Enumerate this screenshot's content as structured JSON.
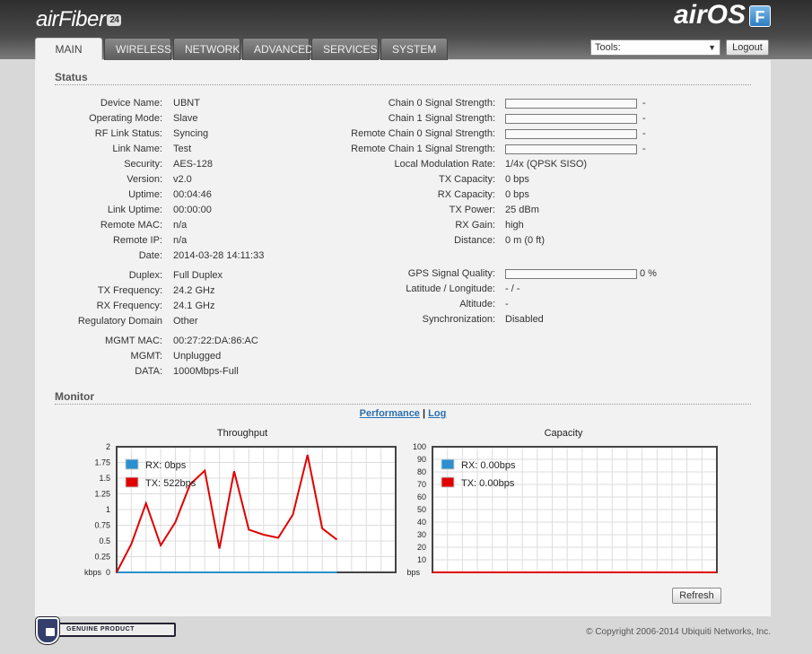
{
  "header": {
    "brand": "airFiber",
    "brand_model": "24",
    "os_name": "airOS",
    "os_badge": "F",
    "tabs": [
      {
        "label": "MAIN",
        "active": true
      },
      {
        "label": "WIRELESS",
        "active": false
      },
      {
        "label": "NETWORK",
        "active": false
      },
      {
        "label": "ADVANCED",
        "active": false
      },
      {
        "label": "SERVICES",
        "active": false
      },
      {
        "label": "SYSTEM",
        "active": false
      }
    ],
    "tools_label": "Tools:",
    "logout_label": "Logout"
  },
  "status": {
    "title": "Status",
    "left": [
      {
        "label": "Device Name:",
        "value": "UBNT"
      },
      {
        "label": "Operating Mode:",
        "value": "Slave"
      },
      {
        "label": "RF Link Status:",
        "value": "Syncing"
      },
      {
        "label": "Link Name:",
        "value": "Test"
      },
      {
        "label": "Security:",
        "value": "AES-128"
      },
      {
        "label": "Version:",
        "value": "v2.0"
      },
      {
        "label": "Uptime:",
        "value": "00:04:46"
      },
      {
        "label": "Link Uptime:",
        "value": "00:00:00"
      },
      {
        "label": "Remote MAC:",
        "value": "n/a"
      },
      {
        "label": "Remote IP:",
        "value": "n/a"
      },
      {
        "label": "Date:",
        "value": "2014-03-28 14:11:33"
      },
      {
        "label": "Duplex:",
        "value": "Full Duplex"
      },
      {
        "label": "TX Frequency:",
        "value": "24.2 GHz"
      },
      {
        "label": "RX Frequency:",
        "value": "24.1 GHz"
      },
      {
        "label": "Regulatory Domain",
        "value": "Other"
      },
      {
        "label": "MGMT MAC:",
        "value": "00:27:22:DA:86:AC"
      },
      {
        "label": "MGMT:",
        "value": "Unplugged"
      },
      {
        "label": "DATA:",
        "value": "1000Mbps-Full"
      }
    ],
    "signal": [
      {
        "label": "Chain 0 Signal Strength:",
        "value": "-",
        "level": 0
      },
      {
        "label": "Chain 1 Signal Strength:",
        "value": "-",
        "level": 0
      },
      {
        "label": "Remote Chain 0 Signal Strength:",
        "value": "-",
        "level": 0
      },
      {
        "label": "Remote Chain 1 Signal Strength:",
        "value": "-",
        "level": 0
      }
    ],
    "right": [
      {
        "label": "Local Modulation Rate:",
        "value": "1/4x (QPSK SISO)"
      },
      {
        "label": "TX Capacity:",
        "value": "0 bps"
      },
      {
        "label": "RX Capacity:",
        "value": "0 bps"
      },
      {
        "label": "TX Power:",
        "value": "25 dBm"
      },
      {
        "label": "RX Gain:",
        "value": "high"
      },
      {
        "label": "Distance:",
        "value": "0 m (0 ft)"
      }
    ],
    "gps": {
      "label": "GPS Signal Quality:",
      "value": "0 %",
      "level": 0
    },
    "right2": [
      {
        "label": "Latitude / Longitude:",
        "value": "- / -"
      },
      {
        "label": "Altitude:",
        "value": "-"
      },
      {
        "label": "Synchronization:",
        "value": "Disabled"
      }
    ]
  },
  "monitor": {
    "title": "Monitor",
    "link_performance": "Performance",
    "separator": "|",
    "link_log": "Log",
    "refresh_label": "Refresh"
  },
  "chart_data": [
    {
      "type": "line",
      "title": "Throughput",
      "ylabel": "kbps",
      "ylim": [
        0,
        2
      ],
      "yticks": [
        "0",
        "0.25",
        "0.5",
        "0.75",
        "1",
        "1.25",
        "1.5",
        "1.75",
        "2"
      ],
      "grid": true,
      "legend": "top-left",
      "x": [
        0,
        1,
        2,
        3,
        4,
        5,
        6,
        7,
        8,
        9,
        10,
        11,
        12,
        13,
        14,
        15
      ],
      "xlim": [
        0,
        19
      ],
      "series": [
        {
          "name": "RX: 0bps",
          "color": "#2b8fd0",
          "values": [
            0,
            0,
            0,
            0,
            0,
            0,
            0,
            0,
            0,
            0,
            0,
            0,
            0,
            0,
            0,
            0
          ]
        },
        {
          "name": "TX: 522bps",
          "color": "#e00000",
          "values": [
            0,
            0.45,
            1.1,
            0.43,
            0.8,
            1.4,
            1.62,
            0.38,
            1.61,
            0.68,
            0.6,
            0.55,
            0.92,
            1.87,
            0.7,
            0.52
          ]
        }
      ]
    },
    {
      "type": "line",
      "title": "Capacity",
      "ylabel": "bps",
      "ylim": [
        0,
        100
      ],
      "yticks": [
        "10",
        "20",
        "30",
        "40",
        "50",
        "60",
        "70",
        "80",
        "90",
        "100"
      ],
      "grid": true,
      "legend": "top-left",
      "x": [
        0,
        19
      ],
      "xlim": [
        0,
        19
      ],
      "series": [
        {
          "name": "RX: 0.00bps",
          "color": "#2b8fd0",
          "values": [
            0,
            0
          ]
        },
        {
          "name": "TX: 0.00bps",
          "color": "#e00000",
          "values": [
            0,
            0
          ]
        }
      ]
    }
  ],
  "footer": {
    "genuine_label": "GENUINE  PRODUCT",
    "copyright": "© Copyright 2006-2014 Ubiquiti Networks, Inc."
  }
}
